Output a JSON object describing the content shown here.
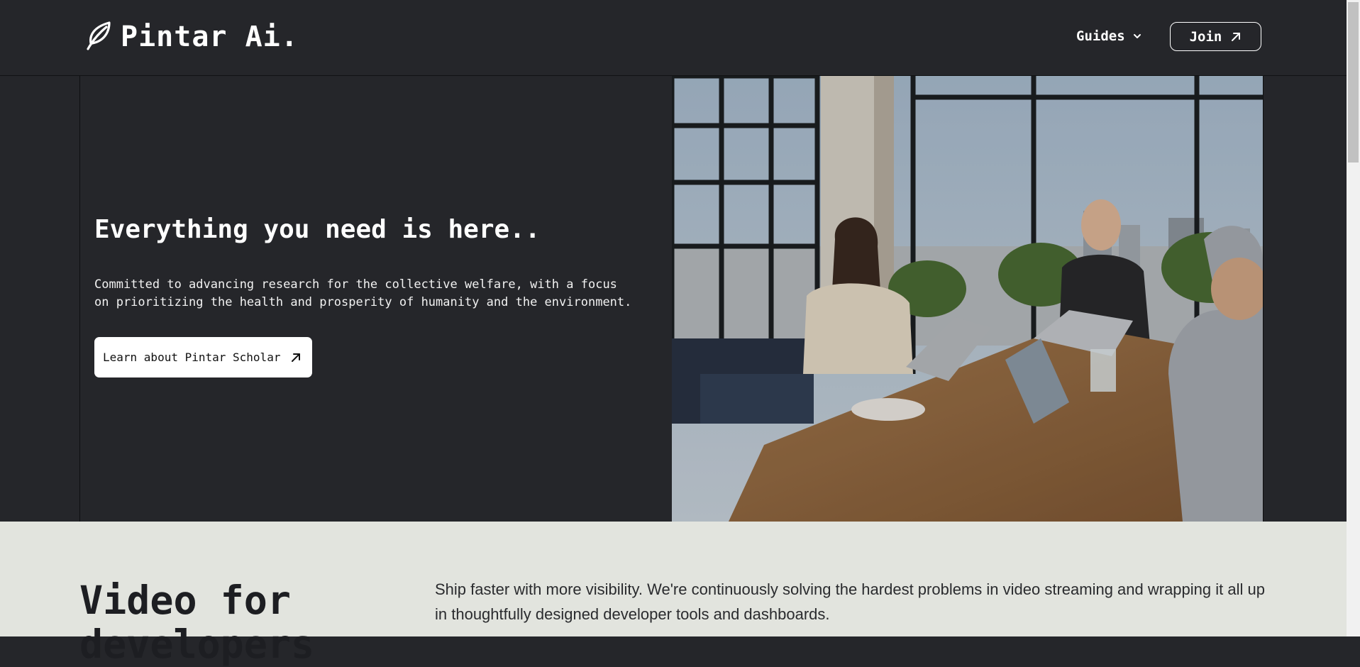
{
  "header": {
    "logo_text": "Pintar Ai.",
    "nav_guides": "Guides",
    "join_label": "Join"
  },
  "hero": {
    "title": "Everything you need is here..",
    "description": "Committed to advancing research for the collective welfare, with a focus on prioritizing the health and prosperity of humanity and the environment.",
    "cta_label": "Learn about Pintar Scholar"
  },
  "section2": {
    "title": "Video for developers",
    "text": "Ship faster with more visibility. We're continuously solving the hardest problems in video streaming and wrapping it all up in thoughtfully designed developer tools and dashboards."
  },
  "icons": {
    "logo": "feather-icon",
    "guides": "chevron-down-icon",
    "join": "arrow-up-right-icon",
    "cta": "arrow-up-right-icon"
  },
  "colors": {
    "dark_bg": "#25262a",
    "light_bg": "#e2e4de",
    "text_dark": "#1d1e22"
  }
}
